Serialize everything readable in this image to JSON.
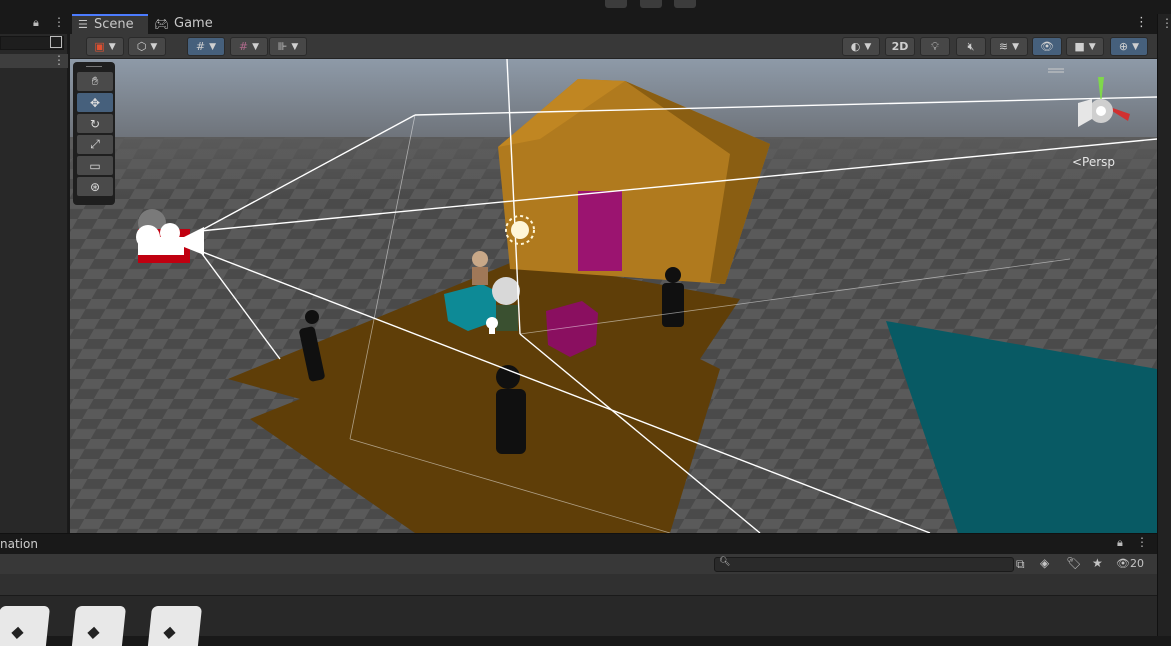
{
  "tabs": {
    "scene": "Scene",
    "game": "Game"
  },
  "toolbar": {
    "mode_2d": "2D"
  },
  "viewport": {
    "projection_label": "<Persp"
  },
  "tools": [
    "hand-tool",
    "move-tool",
    "rotate-tool",
    "scale-tool",
    "rect-tool",
    "transform-tool"
  ],
  "bottom": {
    "panel_label": "nation",
    "visibility_count": "20"
  },
  "colors": {
    "accent": "#4c7cff",
    "active_button": "#46607c",
    "house": "#b07a1e",
    "door": "#9b1470",
    "floor": "#5f3e08",
    "teal": "#085a64"
  }
}
